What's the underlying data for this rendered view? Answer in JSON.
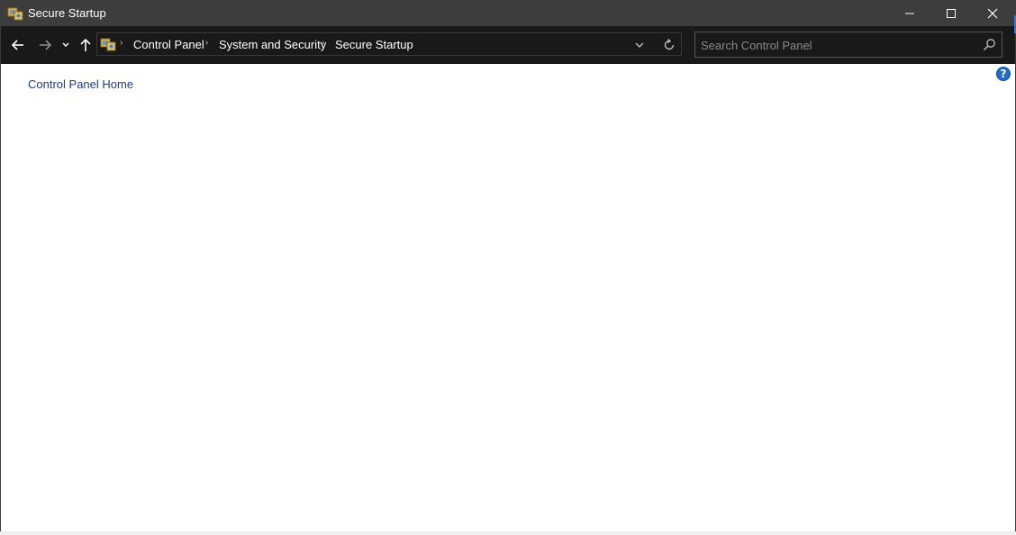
{
  "window": {
    "title": "Secure Startup"
  },
  "address_bar": {
    "breadcrumbs": [
      "Control Panel",
      "System and Security",
      "Secure Startup"
    ]
  },
  "search": {
    "placeholder": "Search Control Panel",
    "value": ""
  },
  "content": {
    "home_link": "Control Panel Home",
    "help_symbol": "?"
  },
  "icons": {
    "app": "control-panel-icon",
    "back": "back-arrow-icon",
    "forward": "forward-arrow-icon",
    "recent": "chevron-down-icon",
    "up": "up-arrow-icon",
    "refresh": "refresh-icon",
    "search": "search-icon",
    "help": "help-icon",
    "minimize": "minimize-icon",
    "maximize": "maximize-icon",
    "close": "close-icon"
  },
  "colors": {
    "titlebar": "#3d3d3d",
    "addressbar": "#191919",
    "link": "#1a3c8c",
    "help": "#1f6cc9"
  }
}
